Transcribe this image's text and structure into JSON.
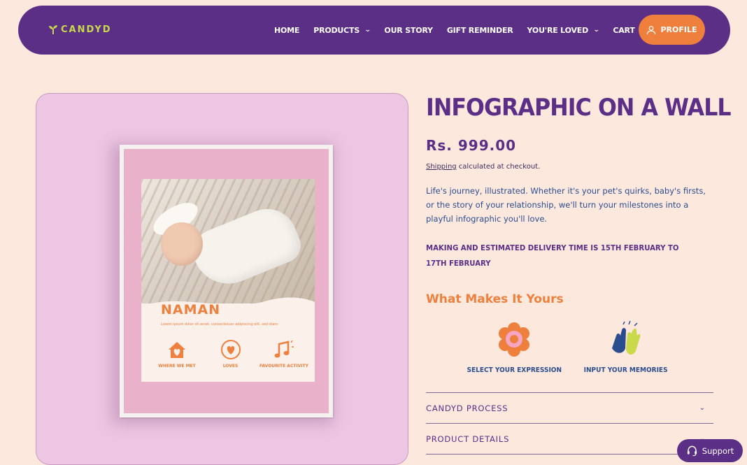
{
  "nav": {
    "logo": "CANDYD",
    "items": [
      {
        "label": "HOME",
        "dropdown": false
      },
      {
        "label": "PRODUCTS",
        "dropdown": true
      },
      {
        "label": "OUR STORY",
        "dropdown": false
      },
      {
        "label": "GIFT REMINDER",
        "dropdown": false
      },
      {
        "label": "YOU'RE LOVED",
        "dropdown": true
      },
      {
        "label": "CART",
        "dropdown": false
      }
    ],
    "profile_label": "PROFILE"
  },
  "media": {
    "poster_name": "NAMAN",
    "poster_text": "Lorem ipsum dolor sit amet, consectetuer adipiscing elit, sed diam",
    "poster_icons": [
      {
        "label": "WHERE WE MET",
        "icon": "house-heart-icon"
      },
      {
        "label": "LOVES",
        "icon": "heart-circle-icon"
      },
      {
        "label": "FAVOURITE ACTIVITY",
        "icon": "music-notes-icon"
      }
    ]
  },
  "product": {
    "title": "INFOGRAPHIC ON A WALL",
    "price": "Rs. 999.00",
    "shipping_link": "Shipping",
    "shipping_rest": " calculated at checkout.",
    "description": "Life's journey, illustrated. Whether it's your pet's quirks, baby's firsts, or the story of your relationship, we'll turn your milestones into a playful infographic you'll love.",
    "delivery": "MAKING AND ESTIMATED DELIVERY TIME IS 15TH FEBRUARY TO 17TH FEBRUARY",
    "section_title": "What Makes It Yours",
    "features": [
      {
        "label": "SELECT YOUR EXPRESSION",
        "icon": "flower-icon"
      },
      {
        "label": "INPUT YOUR MEMORIES",
        "icon": "high-five-icon"
      }
    ],
    "accordions": [
      {
        "label": "CANDYD PROCESS"
      },
      {
        "label": "PRODUCT DETAILS"
      }
    ]
  },
  "support_label": "Support",
  "colors": {
    "background": "#fde8de",
    "nav": "#5b2f86",
    "accent_orange": "#ef7f3d",
    "logo_lime": "#c8d94a",
    "text_blue": "#2a4d8f",
    "media_pink": "#ecc6e2"
  }
}
